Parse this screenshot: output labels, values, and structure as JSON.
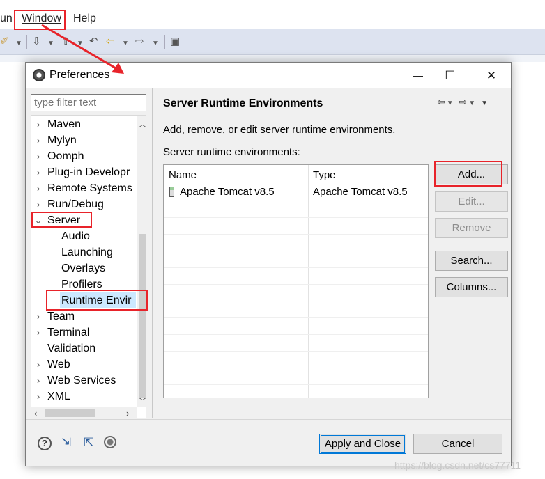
{
  "menubar": {
    "items": [
      "un",
      "Window",
      "Help"
    ]
  },
  "dialog": {
    "title": "Preferences",
    "minimize_glyph": "—",
    "maximize_glyph": "☐",
    "close_glyph": "✕",
    "filter_placeholder": "type filter text",
    "tree": [
      {
        "label": "Maven"
      },
      {
        "label": "Mylyn"
      },
      {
        "label": "Oomph"
      },
      {
        "label": "Plug-in Developr"
      },
      {
        "label": "Remote Systems"
      },
      {
        "label": "Run/Debug"
      },
      {
        "label": "Server"
      },
      {
        "label": "Audio"
      },
      {
        "label": "Launching"
      },
      {
        "label": "Overlays"
      },
      {
        "label": "Profilers"
      },
      {
        "label": "Runtime Envir"
      },
      {
        "label": "Team"
      },
      {
        "label": "Terminal"
      },
      {
        "label": "Validation"
      },
      {
        "label": "Web"
      },
      {
        "label": "Web Services"
      },
      {
        "label": "XML"
      }
    ],
    "page": {
      "title": "Server Runtime Environments",
      "description": "Add, remove, or edit server runtime environments.",
      "list_label": "Server runtime environments:",
      "columns": [
        "Name",
        "Type"
      ],
      "rows": [
        {
          "name": "Apache Tomcat v8.5",
          "type": "Apache Tomcat v8.5"
        }
      ],
      "buttons": {
        "add": "Add...",
        "edit": "Edit...",
        "remove": "Remove",
        "search": "Search...",
        "columns": "Columns..."
      }
    },
    "footer": {
      "apply_close": "Apply and Close",
      "cancel": "Cancel"
    }
  },
  "watermark": "https://blog.csdn.net/cs77711",
  "colors": {
    "selection": "#cce8ff",
    "annotation_red": "#e8232a",
    "toolbar_bg": "#dde3f0",
    "default_button_border": "#0078d7"
  }
}
